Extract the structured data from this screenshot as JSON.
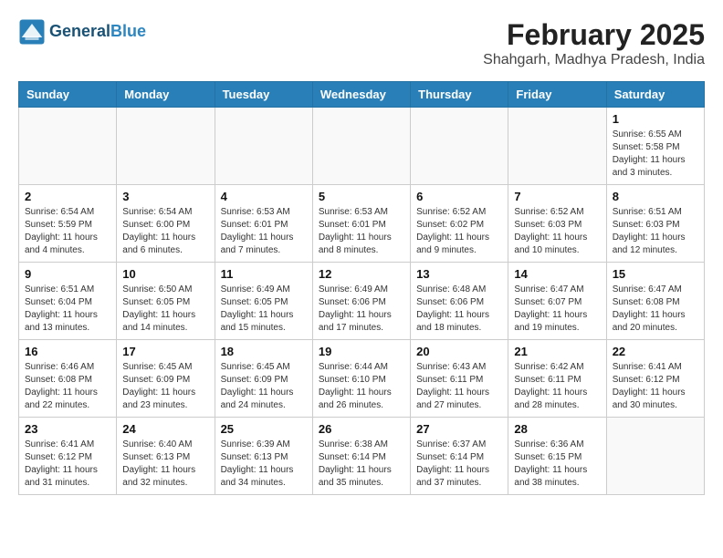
{
  "header": {
    "logo_line1": "General",
    "logo_line2": "Blue",
    "title": "February 2025",
    "subtitle": "Shahgarh, Madhya Pradesh, India"
  },
  "weekdays": [
    "Sunday",
    "Monday",
    "Tuesday",
    "Wednesday",
    "Thursday",
    "Friday",
    "Saturday"
  ],
  "weeks": [
    [
      {
        "day": "",
        "info": ""
      },
      {
        "day": "",
        "info": ""
      },
      {
        "day": "",
        "info": ""
      },
      {
        "day": "",
        "info": ""
      },
      {
        "day": "",
        "info": ""
      },
      {
        "day": "",
        "info": ""
      },
      {
        "day": "1",
        "info": "Sunrise: 6:55 AM\nSunset: 5:58 PM\nDaylight: 11 hours\nand 3 minutes."
      }
    ],
    [
      {
        "day": "2",
        "info": "Sunrise: 6:54 AM\nSunset: 5:59 PM\nDaylight: 11 hours\nand 4 minutes."
      },
      {
        "day": "3",
        "info": "Sunrise: 6:54 AM\nSunset: 6:00 PM\nDaylight: 11 hours\nand 6 minutes."
      },
      {
        "day": "4",
        "info": "Sunrise: 6:53 AM\nSunset: 6:01 PM\nDaylight: 11 hours\nand 7 minutes."
      },
      {
        "day": "5",
        "info": "Sunrise: 6:53 AM\nSunset: 6:01 PM\nDaylight: 11 hours\nand 8 minutes."
      },
      {
        "day": "6",
        "info": "Sunrise: 6:52 AM\nSunset: 6:02 PM\nDaylight: 11 hours\nand 9 minutes."
      },
      {
        "day": "7",
        "info": "Sunrise: 6:52 AM\nSunset: 6:03 PM\nDaylight: 11 hours\nand 10 minutes."
      },
      {
        "day": "8",
        "info": "Sunrise: 6:51 AM\nSunset: 6:03 PM\nDaylight: 11 hours\nand 12 minutes."
      }
    ],
    [
      {
        "day": "9",
        "info": "Sunrise: 6:51 AM\nSunset: 6:04 PM\nDaylight: 11 hours\nand 13 minutes."
      },
      {
        "day": "10",
        "info": "Sunrise: 6:50 AM\nSunset: 6:05 PM\nDaylight: 11 hours\nand 14 minutes."
      },
      {
        "day": "11",
        "info": "Sunrise: 6:49 AM\nSunset: 6:05 PM\nDaylight: 11 hours\nand 15 minutes."
      },
      {
        "day": "12",
        "info": "Sunrise: 6:49 AM\nSunset: 6:06 PM\nDaylight: 11 hours\nand 17 minutes."
      },
      {
        "day": "13",
        "info": "Sunrise: 6:48 AM\nSunset: 6:06 PM\nDaylight: 11 hours\nand 18 minutes."
      },
      {
        "day": "14",
        "info": "Sunrise: 6:47 AM\nSunset: 6:07 PM\nDaylight: 11 hours\nand 19 minutes."
      },
      {
        "day": "15",
        "info": "Sunrise: 6:47 AM\nSunset: 6:08 PM\nDaylight: 11 hours\nand 20 minutes."
      }
    ],
    [
      {
        "day": "16",
        "info": "Sunrise: 6:46 AM\nSunset: 6:08 PM\nDaylight: 11 hours\nand 22 minutes."
      },
      {
        "day": "17",
        "info": "Sunrise: 6:45 AM\nSunset: 6:09 PM\nDaylight: 11 hours\nand 23 minutes."
      },
      {
        "day": "18",
        "info": "Sunrise: 6:45 AM\nSunset: 6:09 PM\nDaylight: 11 hours\nand 24 minutes."
      },
      {
        "day": "19",
        "info": "Sunrise: 6:44 AM\nSunset: 6:10 PM\nDaylight: 11 hours\nand 26 minutes."
      },
      {
        "day": "20",
        "info": "Sunrise: 6:43 AM\nSunset: 6:11 PM\nDaylight: 11 hours\nand 27 minutes."
      },
      {
        "day": "21",
        "info": "Sunrise: 6:42 AM\nSunset: 6:11 PM\nDaylight: 11 hours\nand 28 minutes."
      },
      {
        "day": "22",
        "info": "Sunrise: 6:41 AM\nSunset: 6:12 PM\nDaylight: 11 hours\nand 30 minutes."
      }
    ],
    [
      {
        "day": "23",
        "info": "Sunrise: 6:41 AM\nSunset: 6:12 PM\nDaylight: 11 hours\nand 31 minutes."
      },
      {
        "day": "24",
        "info": "Sunrise: 6:40 AM\nSunset: 6:13 PM\nDaylight: 11 hours\nand 32 minutes."
      },
      {
        "day": "25",
        "info": "Sunrise: 6:39 AM\nSunset: 6:13 PM\nDaylight: 11 hours\nand 34 minutes."
      },
      {
        "day": "26",
        "info": "Sunrise: 6:38 AM\nSunset: 6:14 PM\nDaylight: 11 hours\nand 35 minutes."
      },
      {
        "day": "27",
        "info": "Sunrise: 6:37 AM\nSunset: 6:14 PM\nDaylight: 11 hours\nand 37 minutes."
      },
      {
        "day": "28",
        "info": "Sunrise: 6:36 AM\nSunset: 6:15 PM\nDaylight: 11 hours\nand 38 minutes."
      },
      {
        "day": "",
        "info": ""
      }
    ]
  ]
}
